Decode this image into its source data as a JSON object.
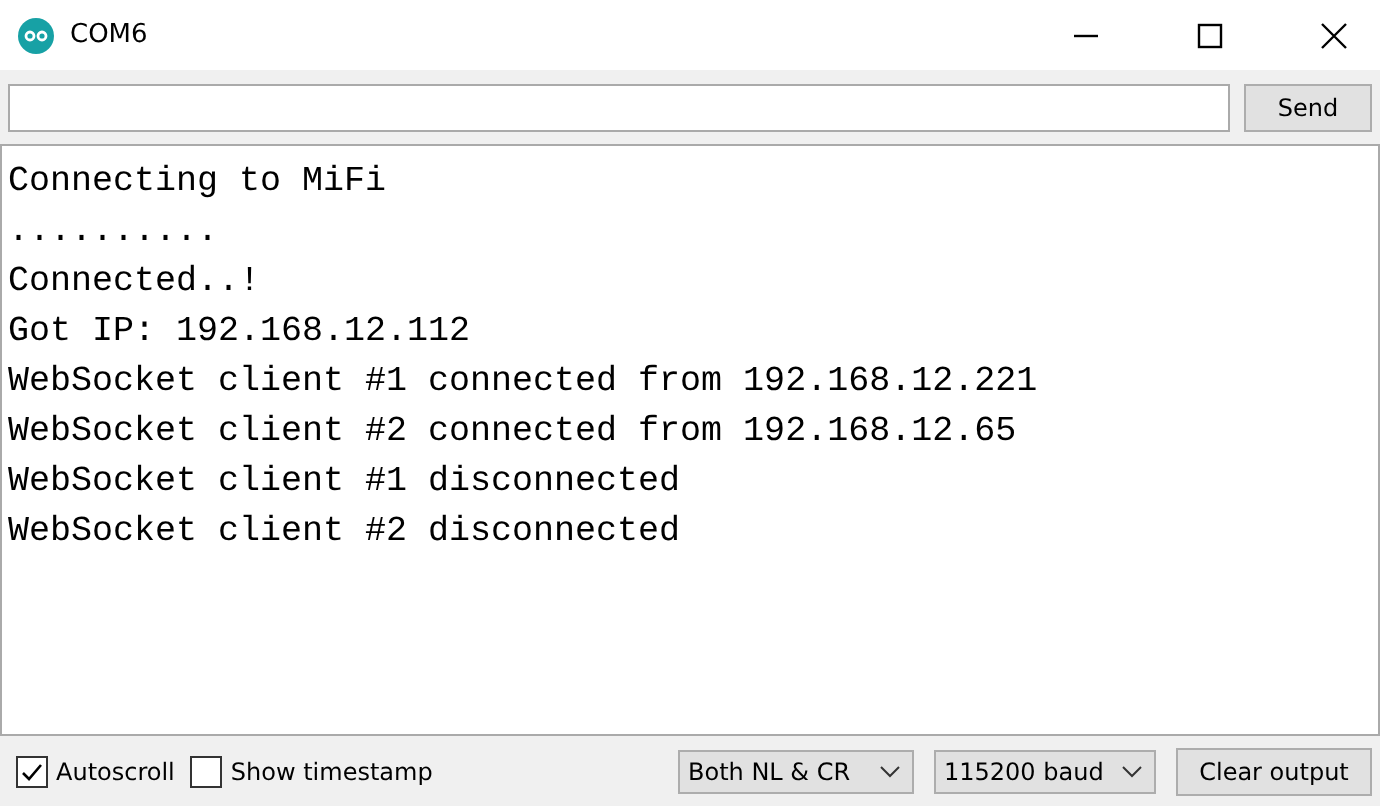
{
  "window": {
    "title": "COM6"
  },
  "send_button": "Send",
  "output_lines": [
    "Connecting to MiFi",
    "..........",
    "Connected..!",
    "Got IP: 192.168.12.112",
    "WebSocket client #1 connected from 192.168.12.221",
    "WebSocket client #2 connected from 192.168.12.65",
    "WebSocket client #1 disconnected",
    "WebSocket client #2 disconnected"
  ],
  "options": [
    {
      "label": "Autoscroll",
      "checked": true
    },
    {
      "label": "Show timestamp",
      "checked": false
    }
  ],
  "dropdowns": [
    "Both NL & CR",
    "115200 baud"
  ],
  "clear_button": "Clear output"
}
